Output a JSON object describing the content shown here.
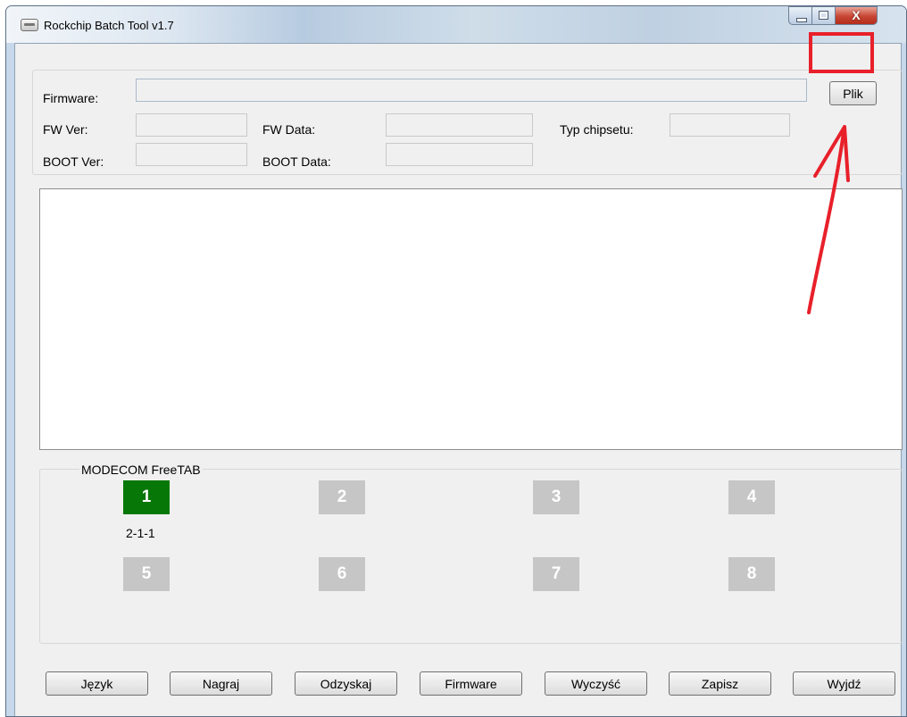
{
  "window": {
    "title": "Rockchip Batch Tool v1.7",
    "close_glyph": "X"
  },
  "icons": {
    "app": "rockchip-app-icon",
    "minimize": "minimize-icon",
    "maximize": "maximize-icon",
    "close": "close-icon"
  },
  "info": {
    "firmware_label": "Firmware:",
    "firmware_value": "",
    "plik_button": "Plik",
    "fw_ver_label": "FW Ver:",
    "fw_ver_value": "",
    "fw_data_label": "FW Data:",
    "fw_data_value": "",
    "chipset_label": "Typ chipsetu:",
    "chipset_value": "",
    "boot_ver_label": "BOOT Ver:",
    "boot_ver_value": "",
    "boot_data_label": "BOOT Data:",
    "boot_data_value": ""
  },
  "log": {
    "text": ""
  },
  "devices": {
    "group_label": "MODECOM FreeTAB",
    "slots": [
      "1",
      "2",
      "3",
      "4",
      "5",
      "6",
      "7",
      "8"
    ],
    "active_slot": "1",
    "active_color": "#077807",
    "inactive_color": "#c6c6c6",
    "slot1_port": "2-1-1"
  },
  "buttons": {
    "language": "Język",
    "flash": "Nagraj",
    "restore": "Odzyskaj",
    "firmware": "Firmware",
    "clear": "Wyczyść",
    "save": "Zapisz",
    "exit": "Wyjdź"
  },
  "annotation": {
    "highlight_color": "#e8202a"
  }
}
